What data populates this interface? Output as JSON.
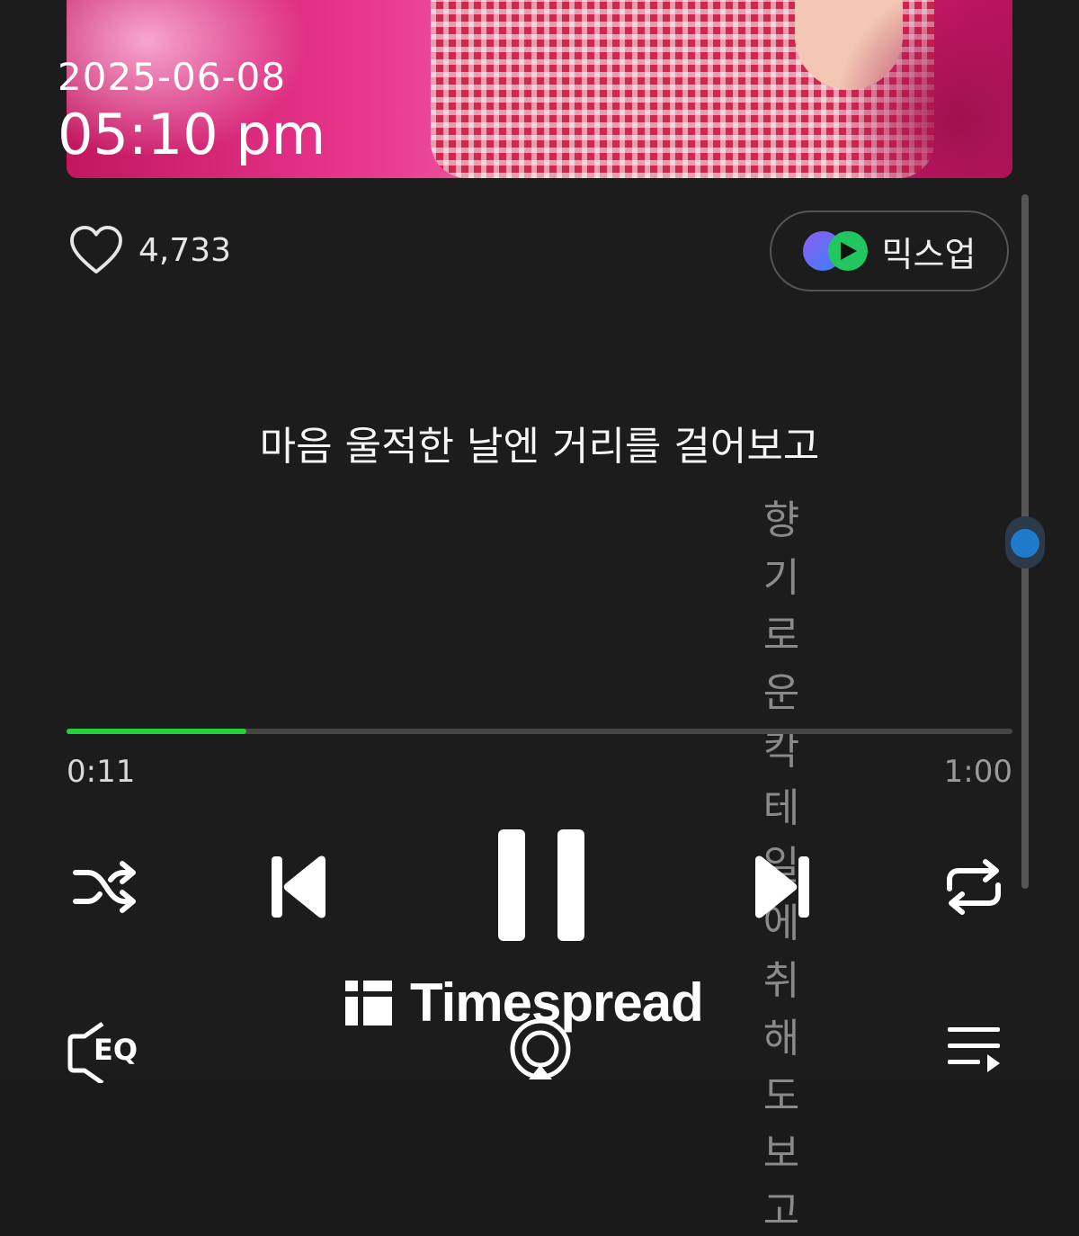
{
  "status": {
    "date": "2025-06-08",
    "time": "05:10 pm"
  },
  "like": {
    "count": "4,733",
    "icon": "heart-outline-icon"
  },
  "mixup": {
    "label": "믹스업",
    "icon": "mixup-icon"
  },
  "lyrics": {
    "current": "마음 울적한 날엔 거리를 걸어보고",
    "next": "향기로운 칵테일에 취해도 보고"
  },
  "progress": {
    "elapsed": "0:11",
    "duration": "1:00",
    "fraction": 0.19,
    "fill_color": "#22d03a"
  },
  "controls": {
    "shuffle_icon": "shuffle-icon",
    "previous_icon": "skip-previous-icon",
    "pause_icon": "pause-icon",
    "next_icon": "skip-next-icon",
    "repeat_icon": "repeat-icon"
  },
  "bottom_bar": {
    "eq_label": "EQ",
    "cast_icon": "airplay-icon",
    "playlist_icon": "playlist-icon"
  },
  "watermark": {
    "text": "Timespread"
  },
  "colors": {
    "background": "#1c1c1c",
    "accent": "#22d03a",
    "scroll_indicator": "#1f7acc"
  }
}
